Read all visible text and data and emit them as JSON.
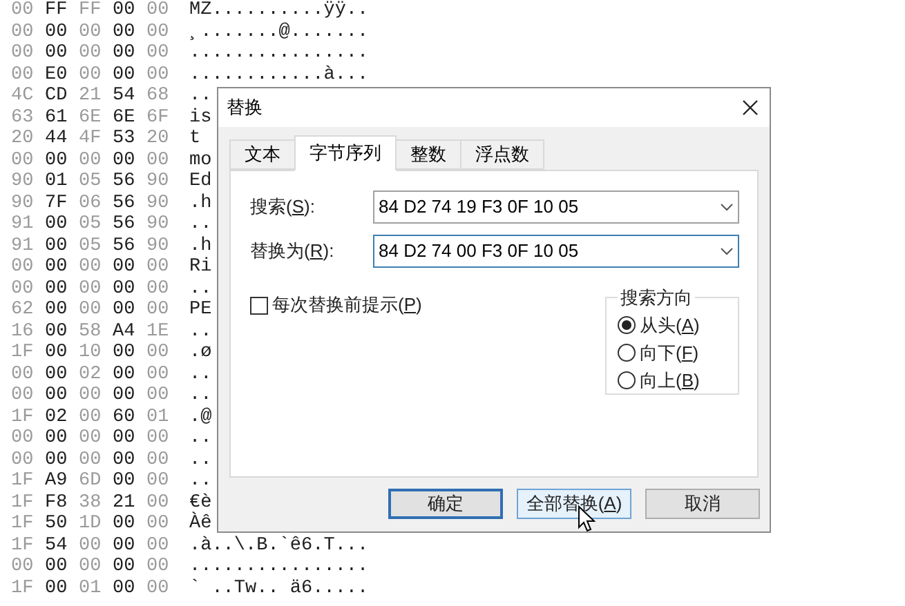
{
  "hex_rows": [
    {
      "bytes": [
        "00",
        "FF",
        "FF",
        "00",
        "00"
      ],
      "ascii": "MZ..........ÿÿ.."
    },
    {
      "bytes": [
        "00",
        "00",
        "00",
        "00",
        "00"
      ],
      "ascii": "¸.......@......."
    },
    {
      "bytes": [
        "00",
        "00",
        "00",
        "00",
        "00"
      ],
      "ascii": "................"
    },
    {
      "bytes": [
        "00",
        "E0",
        "00",
        "00",
        "00"
      ],
      "ascii": "............à..."
    },
    {
      "bytes": [
        "4C",
        "CD",
        "21",
        "54",
        "68"
      ],
      "ascii": ".."
    },
    {
      "bytes": [
        "63",
        "61",
        "6E",
        "6E",
        "6F"
      ],
      "ascii": "is"
    },
    {
      "bytes": [
        "20",
        "44",
        "4F",
        "53",
        "20"
      ],
      "ascii": "t"
    },
    {
      "bytes": [
        "00",
        "00",
        "00",
        "00",
        "00"
      ],
      "ascii": "mo"
    },
    {
      "bytes": [
        "90",
        "01",
        "05",
        "56",
        "90"
      ],
      "ascii": "Ed"
    },
    {
      "bytes": [
        "90",
        "7F",
        "06",
        "56",
        "90"
      ],
      "ascii": ".h"
    },
    {
      "bytes": [
        "91",
        "00",
        "05",
        "56",
        "90"
      ],
      "ascii": ".."
    },
    {
      "bytes": [
        "91",
        "00",
        "05",
        "56",
        "90"
      ],
      "ascii": ".h"
    },
    {
      "bytes": [
        "00",
        "00",
        "00",
        "00",
        "00"
      ],
      "ascii": "Ri"
    },
    {
      "bytes": [
        "00",
        "00",
        "00",
        "00",
        "00"
      ],
      "ascii": ".."
    },
    {
      "bytes": [
        "62",
        "00",
        "00",
        "00",
        "00"
      ],
      "ascii": "PE"
    },
    {
      "bytes": [
        "16",
        "00",
        "58",
        "A4",
        "1E"
      ],
      "ascii": ".."
    },
    {
      "bytes": [
        "1F",
        "00",
        "10",
        "00",
        "00"
      ],
      "ascii": ".ø"
    },
    {
      "bytes": [
        "00",
        "00",
        "02",
        "00",
        "00"
      ],
      "ascii": ".."
    },
    {
      "bytes": [
        "00",
        "00",
        "00",
        "00",
        "00"
      ],
      "ascii": ".."
    },
    {
      "bytes": [
        "1F",
        "02",
        "00",
        "60",
        "01"
      ],
      "ascii": ".@"
    },
    {
      "bytes": [
        "00",
        "00",
        "00",
        "00",
        "00"
      ],
      "ascii": ".."
    },
    {
      "bytes": [
        "00",
        "00",
        "00",
        "00",
        "00"
      ],
      "ascii": ".."
    },
    {
      "bytes": [
        "1F",
        "A9",
        "6D",
        "00",
        "00"
      ],
      "ascii": ".."
    },
    {
      "bytes": [
        "1F",
        "F8",
        "38",
        "21",
        "00"
      ],
      "ascii": "€è"
    },
    {
      "bytes": [
        "1F",
        "50",
        "1D",
        "00",
        "00"
      ],
      "ascii": "Àê"
    },
    {
      "bytes": [
        "1F",
        "54",
        "00",
        "00",
        "00"
      ],
      "ascii": ".à..\\.B.`ê6.T..."
    },
    {
      "bytes": [
        "00",
        "00",
        "00",
        "00",
        "00"
      ],
      "ascii": "................"
    },
    {
      "bytes": [
        "1F",
        "00",
        "01",
        "00",
        "00"
      ],
      "ascii": "` ..Tw.. ä6....."
    }
  ],
  "dialog": {
    "title": "替换",
    "tabs": [
      {
        "label": "文本",
        "selected": false
      },
      {
        "label": "字节序列",
        "selected": true
      },
      {
        "label": "整数",
        "selected": false
      },
      {
        "label": "浮点数",
        "selected": false
      }
    ],
    "fields": [
      {
        "label_parts": [
          "搜索(",
          "S",
          "):"
        ],
        "value": "84 D2 74 19 F3 0F 10 05",
        "focused": false
      },
      {
        "label_parts": [
          "替换为(",
          "R",
          "):"
        ],
        "value": "84 D2 74 00 F3 0F 10 05",
        "focused": true
      }
    ],
    "prompt_checkbox": {
      "label_parts": [
        "每次替换前提示(",
        "P",
        ")"
      ],
      "checked": false
    },
    "direction": {
      "title": "搜索方向",
      "options": [
        {
          "label_parts": [
            "从头(",
            "A",
            ")"
          ],
          "selected": true
        },
        {
          "label_parts": [
            "向下(",
            "F",
            ")"
          ],
          "selected": false
        },
        {
          "label_parts": [
            "向上(",
            "B",
            ")"
          ],
          "selected": false
        }
      ]
    },
    "buttons": [
      {
        "label_parts": [
          "确定"
        ],
        "is_default": true,
        "hovered": false
      },
      {
        "label_parts": [
          "全部替换(",
          "A",
          ")"
        ],
        "is_default": false,
        "hovered": true
      },
      {
        "label_parts": [
          "取消"
        ],
        "is_default": false,
        "hovered": false
      }
    ]
  }
}
